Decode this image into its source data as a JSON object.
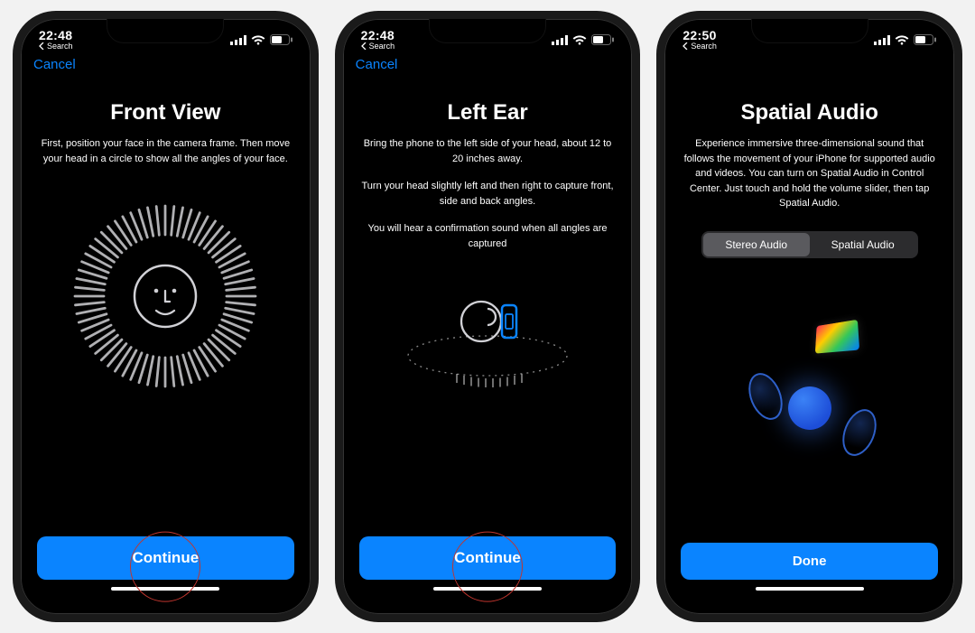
{
  "colors": {
    "accent": "#0a84ff",
    "annotation": "#c1352e"
  },
  "status": {
    "time_a": "22:48",
    "time_b": "22:50",
    "back_label": "Search"
  },
  "screen1": {
    "cancel": "Cancel",
    "title": "Front View",
    "desc1": "First, position your face in the camera frame. Then move your head in a circle to show all the angles of your face.",
    "cta": "Continue"
  },
  "screen2": {
    "cancel": "Cancel",
    "title": "Left Ear",
    "desc1": "Bring the phone to the left side of your head, about 12 to 20 inches away.",
    "desc2": "Turn your head slightly left and then right to capture front, side and back angles.",
    "desc3": "You will hear a confirmation sound when all angles are captured",
    "cta": "Continue"
  },
  "screen3": {
    "title": "Spatial Audio",
    "desc1": "Experience immersive three-dimensional sound that follows the movement of your iPhone for supported audio and videos. You can turn on Spatial Audio in Control Center. Just touch and hold the volume slider, then tap Spatial Audio.",
    "segmented": {
      "option1": "Stereo Audio",
      "option2": "Spatial Audio"
    },
    "cta": "Done"
  }
}
